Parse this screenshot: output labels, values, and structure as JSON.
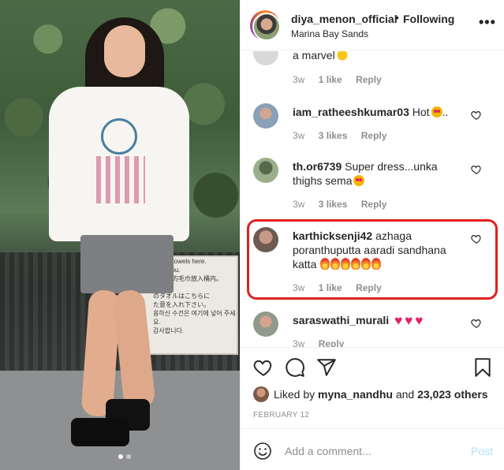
{
  "post": {
    "username": "diya_menon_official",
    "separator": "•",
    "follow_status": "Following",
    "location": "Marina Bay Sands",
    "more_label": "•••"
  },
  "photo": {
    "sign_lines": [
      "r used towels here.",
      "hank you.",
      "",
      "使用过的毛巾放入桶内。",
      "谢谢。",
      "",
      "のタオルはこちらに",
      "た意を入れ下さい。",
      "",
      "용하신 수건은 여기에 넣어 주세요.",
      "감사합니다."
    ]
  },
  "comments": [
    {
      "username": "",
      "text": "a marvel",
      "emoji": "star",
      "time": "3w",
      "likes": "1 like",
      "reply": "Reply"
    },
    {
      "username": "iam_ratheeshkumar03",
      "text": "Hot",
      "emoji": "hot",
      "trail": "..",
      "time": "3w",
      "likes": "3 likes",
      "reply": "Reply"
    },
    {
      "username": "th.or6739",
      "text": "Super dress...unka thighs sema",
      "emoji": "hot",
      "time": "3w",
      "likes": "3 likes",
      "reply": "Reply"
    },
    {
      "username": "karthicksenji42",
      "text": "azhaga poranthuputta aaradi sandhana katta",
      "emoji": "fire",
      "emoji_count": 6,
      "time": "3w",
      "likes": "1 like",
      "reply": "Reply"
    },
    {
      "username": "saraswathi_murali",
      "text": "",
      "emoji": "red-heart",
      "emoji_count": 3,
      "time": "3w",
      "likes": "",
      "reply": "Reply"
    }
  ],
  "actions": {
    "liked_by_prefix": "Liked by",
    "liked_by_user": "myna_nandhu",
    "liked_by_suffix": "and",
    "like_count": "23,023 others",
    "date": "FEBRUARY 12"
  },
  "add_comment": {
    "placeholder": "Add a comment...",
    "post_label": "Post"
  },
  "colors": {
    "highlight": "#e02020",
    "post_button": "#b2dffc",
    "secondary_text": "#8e8e8e"
  }
}
